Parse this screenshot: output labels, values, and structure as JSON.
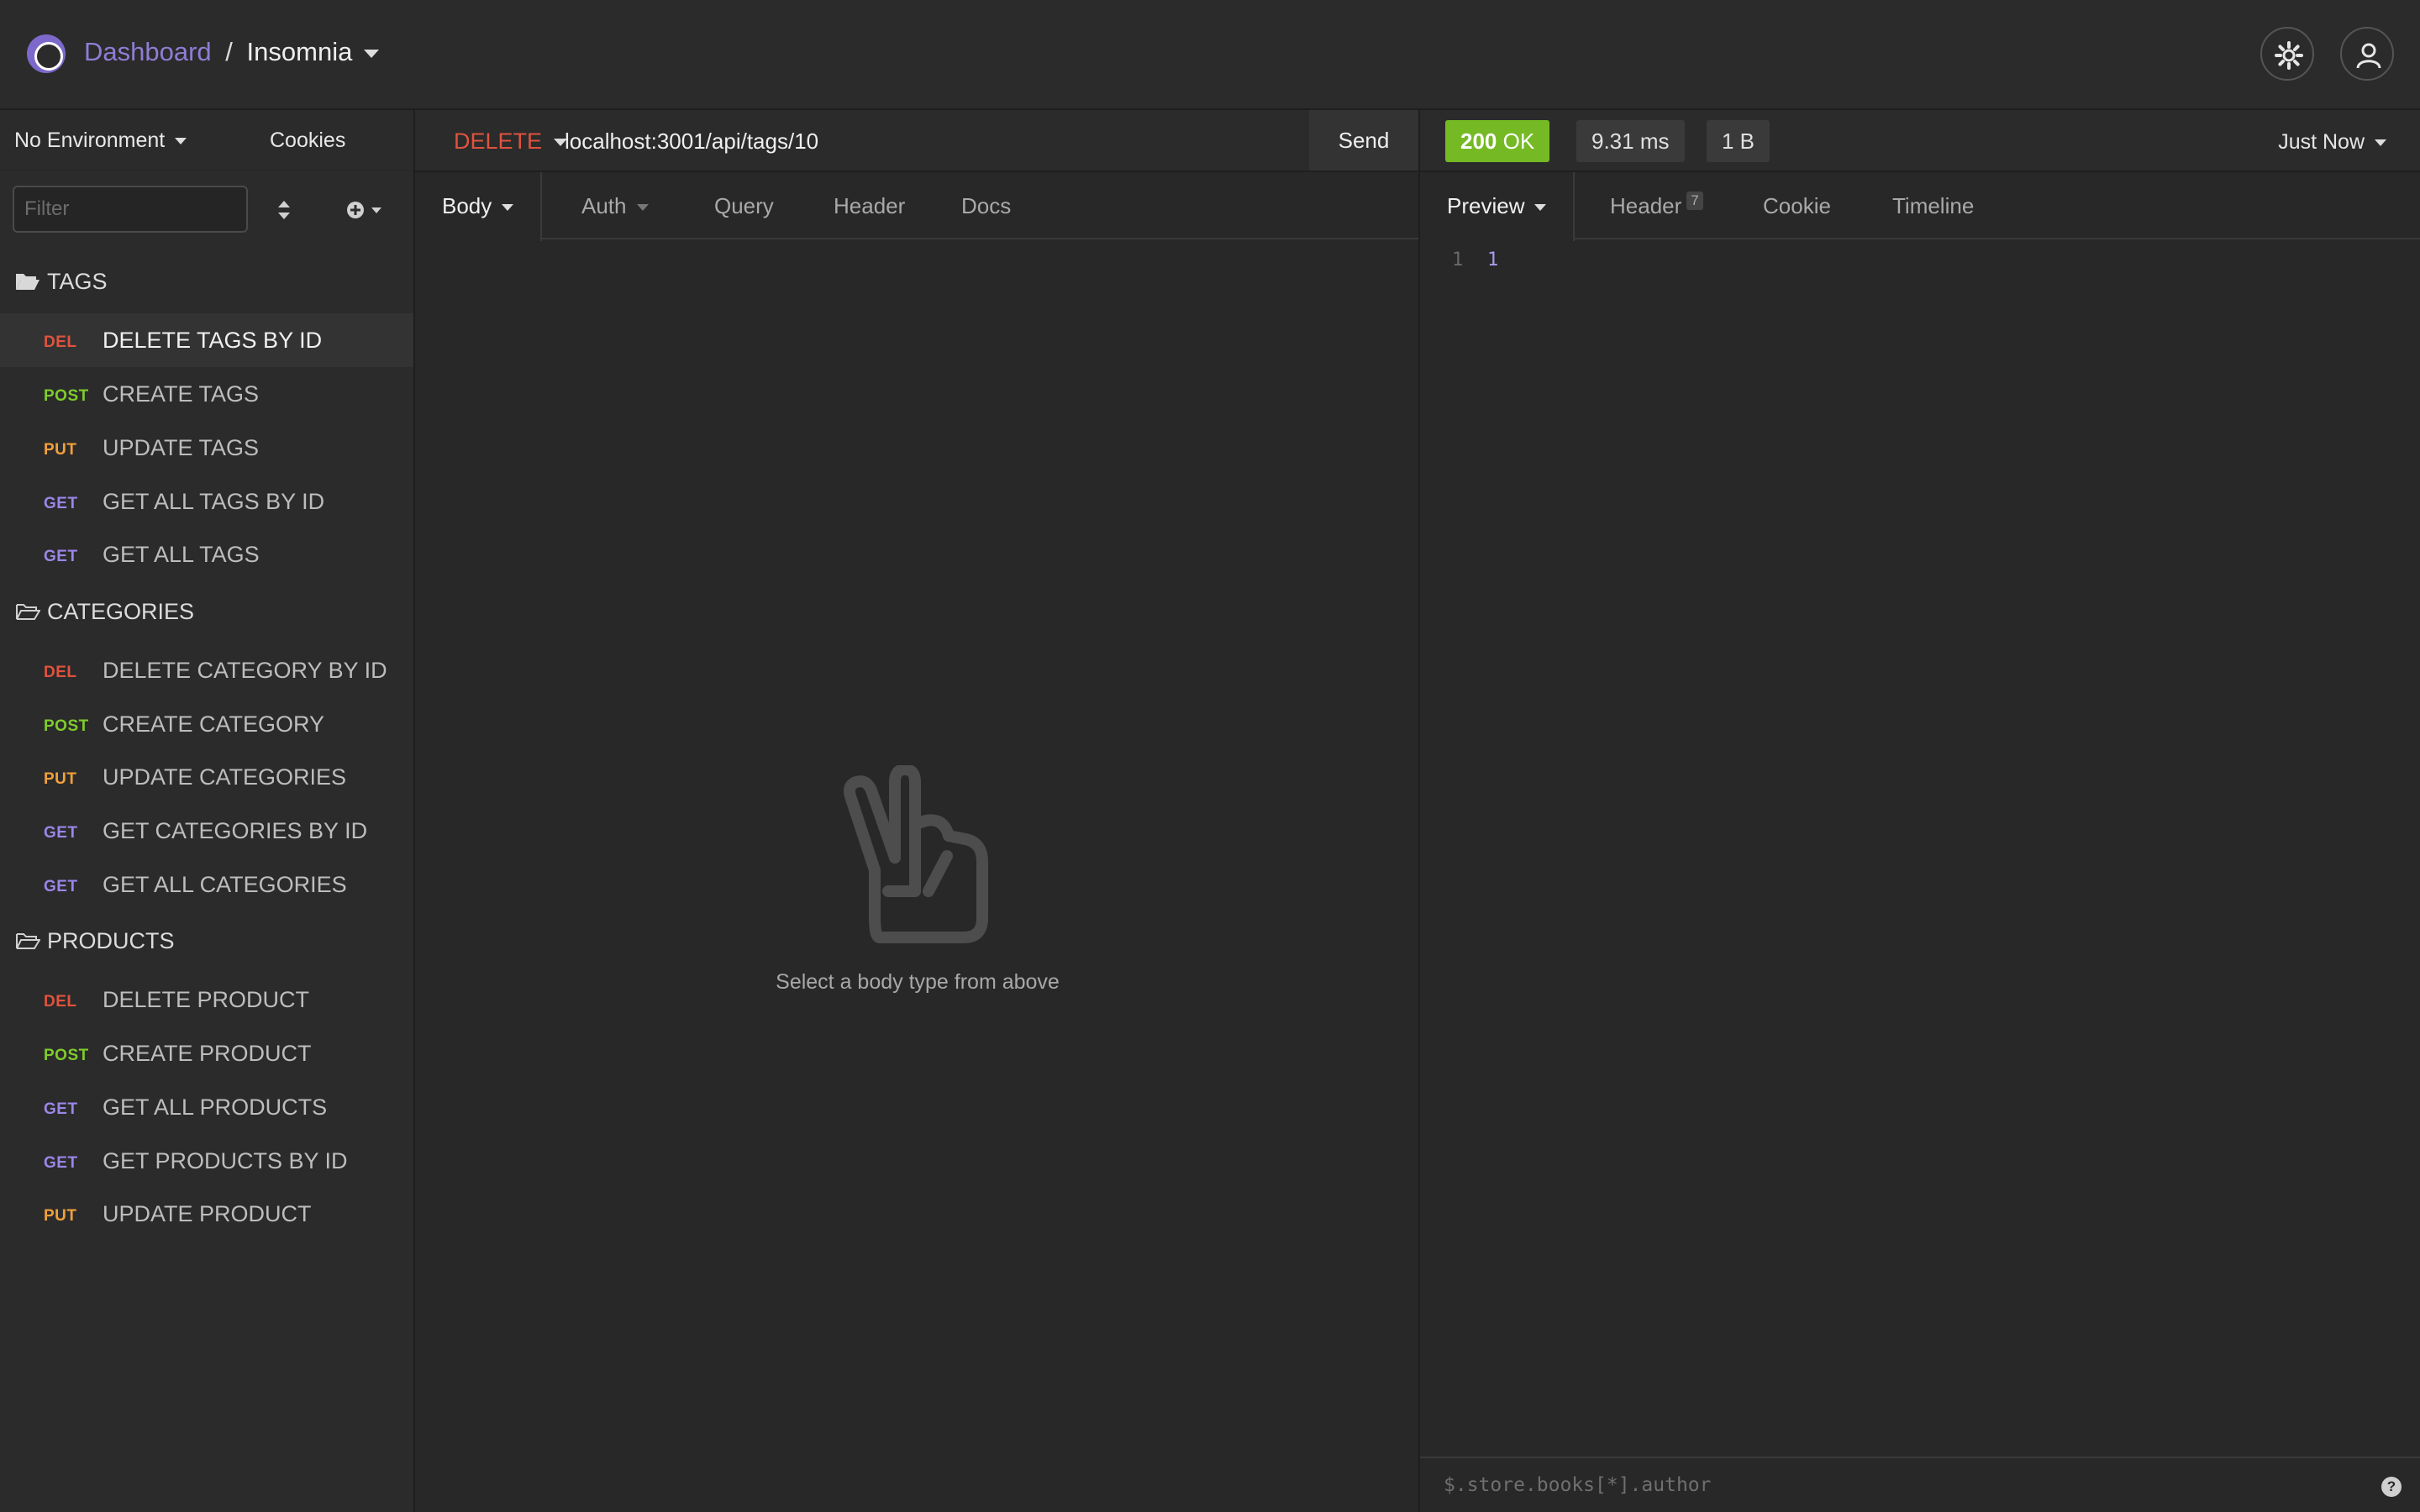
{
  "header": {
    "breadcrumb_link": "Dashboard",
    "separator": "/",
    "workspace": "Insomnia",
    "icons": [
      "logo-icon",
      "caret-down-icon",
      "gear-icon",
      "user-icon"
    ]
  },
  "sidebar": {
    "environment": "No Environment",
    "cookies": "Cookies",
    "filter_placeholder": "Filter",
    "folders": [
      {
        "name": "TAGS",
        "open": true,
        "requests": [
          {
            "method": "DEL",
            "name": "DELETE TAGS BY ID",
            "active": true
          },
          {
            "method": "POST",
            "name": "CREATE TAGS"
          },
          {
            "method": "PUT",
            "name": "UPDATE TAGS"
          },
          {
            "method": "GET",
            "name": "GET ALL TAGS BY ID"
          },
          {
            "method": "GET",
            "name": "GET ALL TAGS"
          }
        ]
      },
      {
        "name": "CATEGORIES",
        "open": false,
        "requests": [
          {
            "method": "DEL",
            "name": "DELETE CATEGORY BY ID"
          },
          {
            "method": "POST",
            "name": "CREATE CATEGORY"
          },
          {
            "method": "PUT",
            "name": "UPDATE CATEGORIES"
          },
          {
            "method": "GET",
            "name": "GET CATEGORIES BY ID"
          },
          {
            "method": "GET",
            "name": "GET ALL CATEGORIES"
          }
        ]
      },
      {
        "name": "PRODUCTS",
        "open": false,
        "requests": [
          {
            "method": "DEL",
            "name": "DELETE PRODUCT"
          },
          {
            "method": "POST",
            "name": "CREATE PRODUCT"
          },
          {
            "method": "GET",
            "name": "GET ALL PRODUCTS"
          },
          {
            "method": "GET",
            "name": "GET PRODUCTS BY ID"
          },
          {
            "method": "PUT",
            "name": "UPDATE PRODUCT"
          }
        ]
      }
    ]
  },
  "request": {
    "method": "DELETE",
    "url": "localhost:3001/api/tags/10",
    "send_label": "Send",
    "tabs": [
      "Body",
      "Auth",
      "Query",
      "Header",
      "Docs"
    ],
    "active_tab": "Body",
    "empty_text": "Select a body type from above"
  },
  "response": {
    "status": "200",
    "status_text": "OK",
    "time": "9.31 ms",
    "size": "1 B",
    "when": "Just Now",
    "tabs": {
      "preview": "Preview",
      "header": "Header",
      "header_count": "7",
      "cookie": "Cookie",
      "timeline": "Timeline"
    },
    "line_number": "1",
    "body_value": "1",
    "filter_placeholder": "$.store.books[*].author",
    "help_label": "?"
  },
  "colors": {
    "accent": "#8f7dd4",
    "del": "#e0533e",
    "post": "#7fcc2b",
    "put": "#f2a03b",
    "get": "#9b86e8",
    "ok": "#75ba24"
  }
}
